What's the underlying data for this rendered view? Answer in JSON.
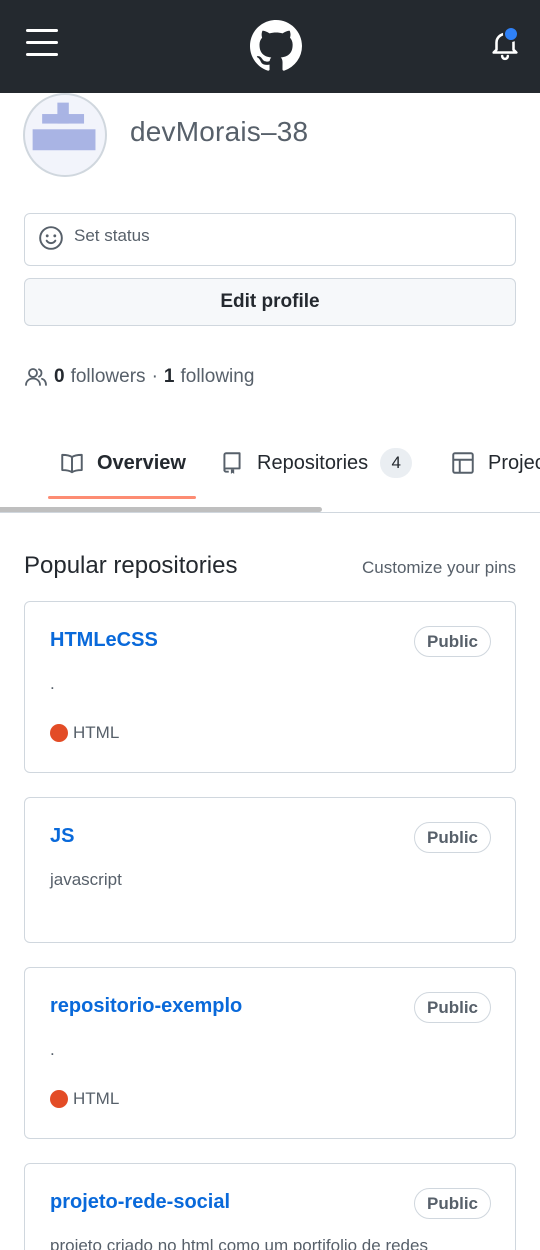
{
  "header": {
    "menu_icon": "hamburger-menu-icon",
    "logo_icon": "github-logo-icon",
    "notification_icon": "bell-icon",
    "notification_dot_color": "#2f81f7"
  },
  "profile": {
    "username": "devMorais–38",
    "set_status_label": "Set status",
    "edit_profile_label": "Edit profile",
    "followers_count": "0",
    "followers_label": "followers",
    "separator": "·",
    "following_count": "1",
    "following_label": "following"
  },
  "tabs": [
    {
      "label": "Overview",
      "icon": "book-icon",
      "active": true
    },
    {
      "label": "Repositories",
      "icon": "repo-icon",
      "count": "4"
    },
    {
      "label": "Projec",
      "icon": "table-icon"
    }
  ],
  "popular": {
    "title": "Popular repositories",
    "customize_label": "Customize your pins",
    "repos": [
      {
        "name": "HTMLeCSS",
        "visibility": "Public",
        "description": ".",
        "language": "HTML",
        "language_color": "#e34c26"
      },
      {
        "name": "JS",
        "visibility": "Public",
        "description": "javascript",
        "language": "",
        "language_color": ""
      },
      {
        "name": "repositorio-exemplo",
        "visibility": "Public",
        "description": ".",
        "language": "HTML",
        "language_color": "#e34c26"
      },
      {
        "name": "projeto-rede-social",
        "visibility": "Public",
        "description": "projeto criado no html como um portifolio de redes",
        "language": "",
        "language_color": ""
      }
    ]
  },
  "colors": {
    "header_bg": "#24292f",
    "link": "#0969da",
    "tab_underline": "#fd8c73"
  }
}
